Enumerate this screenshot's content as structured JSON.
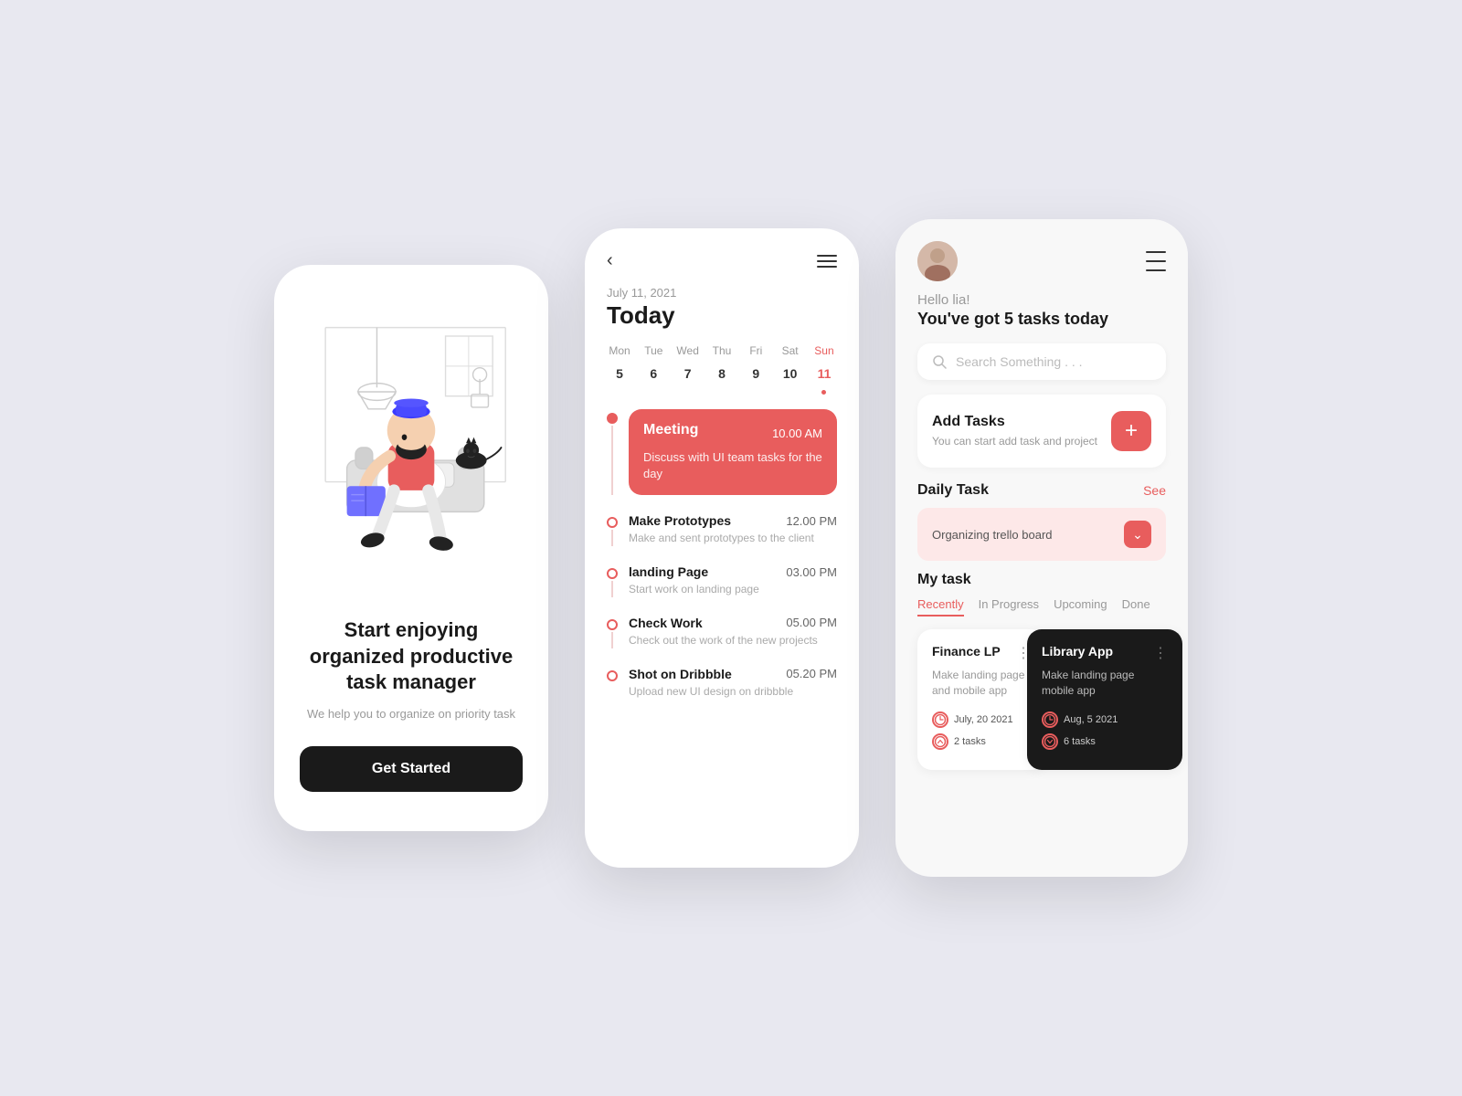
{
  "background": "#e8e8f0",
  "phone1": {
    "tagline": "Start enjoying organized productive task manager",
    "subtitle": "We help you to organize on priority task",
    "button_label": "Get Started"
  },
  "phone2": {
    "back_icon": "‹",
    "date_small": "July 11, 2021",
    "date_big": "Today",
    "week": [
      {
        "name": "Mon",
        "num": "5",
        "active": false
      },
      {
        "name": "Tue",
        "num": "6",
        "active": false
      },
      {
        "name": "Wed",
        "num": "7",
        "active": false
      },
      {
        "name": "Thu",
        "num": "8",
        "active": false
      },
      {
        "name": "Fri",
        "num": "9",
        "active": false
      },
      {
        "name": "Sat",
        "num": "10",
        "active": false
      },
      {
        "name": "Sun",
        "num": "11",
        "active": true
      }
    ],
    "events": [
      {
        "title": "Meeting",
        "time": "10.00 AM",
        "description": "Discuss with UI team tasks for the day",
        "type": "highlighted"
      },
      {
        "title": "Make Prototypes",
        "time": "12.00 PM",
        "description": "Make and sent prototypes to the client",
        "type": "plain"
      },
      {
        "title": "landing Page",
        "time": "03.00 PM",
        "description": "Start work on landing page",
        "type": "plain"
      },
      {
        "title": "Check Work",
        "time": "05.00 PM",
        "description": "Check out the work of the new projects",
        "type": "plain"
      },
      {
        "title": "Shot on Dribbble",
        "time": "05.20 PM",
        "description": "Upload new UI design on dribbble",
        "type": "plain"
      }
    ]
  },
  "phone3": {
    "greeting_hello": "Hello lia!",
    "greeting_tasks": "You've got 5 tasks today",
    "search_placeholder": "Search Something . . .",
    "add_tasks": {
      "title": "Add Tasks",
      "description": "You can start add task and project",
      "button": "+"
    },
    "daily_task": {
      "section_title": "Daily Task",
      "see_label": "See",
      "item": "Organizing trello board"
    },
    "my_task": {
      "section_title": "My task",
      "tabs": [
        "Recently",
        "In Progress",
        "Upcoming",
        "Done"
      ],
      "active_tab": "Recently"
    },
    "task_cards": [
      {
        "title": "Finance LP",
        "description": "Make landing page and mobile app",
        "date": "July, 20 2021",
        "tasks_count": "2 tasks",
        "dark": false
      },
      {
        "title": "Library App",
        "description": "Make landing page mobile app",
        "date": "Aug, 5 2021",
        "tasks_count": "6 tasks",
        "dark": true
      }
    ]
  }
}
